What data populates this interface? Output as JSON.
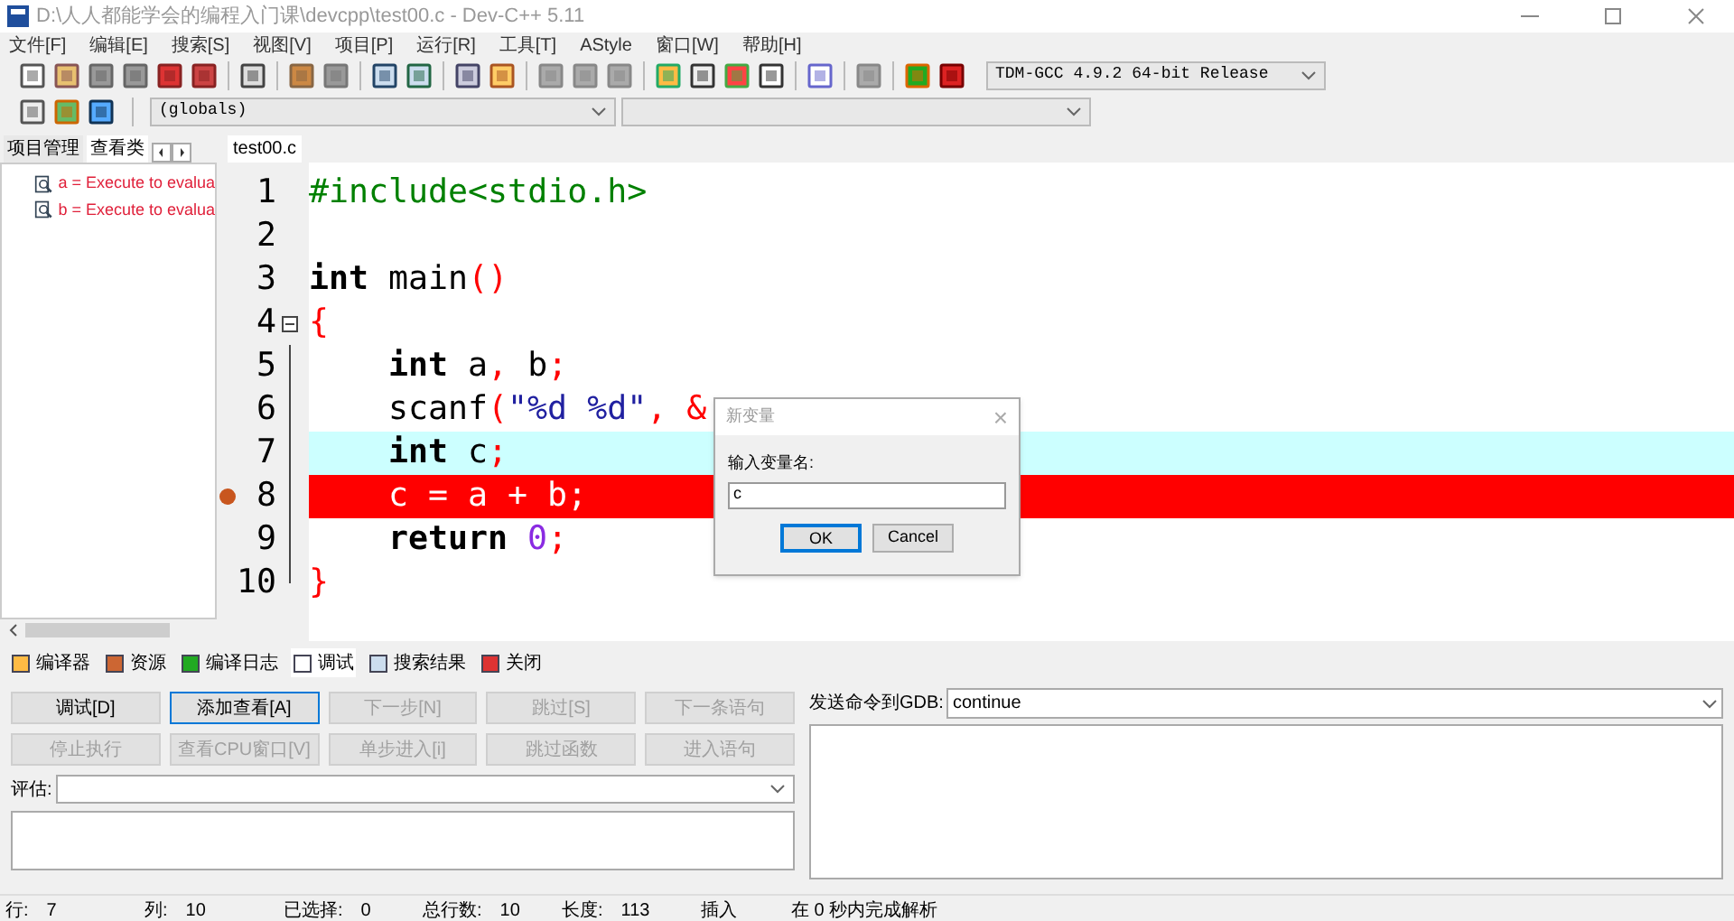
{
  "window": {
    "title": "D:\\人人都能学会的编程入门课\\devcpp\\test00.c - Dev-C++ 5.11"
  },
  "menu": [
    "文件[F]",
    "编辑[E]",
    "搜索[S]",
    "视图[V]",
    "项目[P]",
    "运行[R]",
    "工具[T]",
    "AStyle",
    "窗口[W]",
    "帮助[H]"
  ],
  "compiler_select": {
    "value": "TDM-GCC 4.9.2 64-bit Release"
  },
  "scope_select": {
    "value": "(globals)"
  },
  "left_tabs": [
    {
      "label": "项目管理",
      "selected": false
    },
    {
      "label": "查看类",
      "selected": true
    }
  ],
  "watches": [
    {
      "text": "a = Execute to evalua"
    },
    {
      "text": "b = Execute to evalua"
    }
  ],
  "editor_tabs": [
    {
      "label": "test00.c",
      "selected": true
    }
  ],
  "code_lines": [
    {
      "number": "1",
      "current": false,
      "breakpoint": false,
      "fold": false,
      "tokens": [
        {
          "kind": "pp",
          "text": "#include<stdio.h>"
        }
      ]
    },
    {
      "number": "2",
      "current": false,
      "breakpoint": false,
      "fold": false
    },
    {
      "number": "3",
      "current": false,
      "breakpoint": false,
      "fold": false,
      "tokens": [
        {
          "kind": "kw",
          "text": "int"
        },
        {
          "kind": "plain",
          "text": " main"
        },
        {
          "kind": "sym",
          "text": "()"
        }
      ]
    },
    {
      "number": "4",
      "current": false,
      "breakpoint": false,
      "fold": true,
      "tokens": [
        {
          "kind": "sym",
          "text": "{"
        }
      ]
    },
    {
      "number": "5",
      "current": false,
      "breakpoint": false,
      "fold": false,
      "indented": true,
      "tokens": [
        {
          "kind": "kw",
          "text": "int"
        },
        {
          "kind": "plain",
          "text": " a"
        },
        {
          "kind": "sym",
          "text": ","
        },
        {
          "kind": "plain",
          "text": " b"
        },
        {
          "kind": "sym",
          "text": ";"
        }
      ]
    },
    {
      "number": "6",
      "current": false,
      "breakpoint": false,
      "fold": false,
      "indented": true,
      "tokens": [
        {
          "kind": "plain",
          "text": "scanf"
        },
        {
          "kind": "sym",
          "text": "("
        },
        {
          "kind": "str",
          "text": "\"%d %d\""
        },
        {
          "kind": "sym",
          "text": ", &"
        }
      ]
    },
    {
      "number": "7",
      "current": true,
      "breakpoint": false,
      "fold": false,
      "indented": true,
      "tokens": [
        {
          "kind": "kw",
          "text": "int"
        },
        {
          "kind": "plain",
          "text": " c"
        },
        {
          "kind": "sym",
          "text": ";"
        }
      ]
    },
    {
      "number": "8",
      "current": false,
      "breakpoint": true,
      "fold": false,
      "indented": true,
      "tokens": [
        {
          "kind": "plain",
          "text": "c = a + b;"
        }
      ]
    },
    {
      "number": "9",
      "current": false,
      "breakpoint": false,
      "fold": false,
      "indented": true,
      "tokens": [
        {
          "kind": "kw",
          "text": "return"
        },
        {
          "kind": "num",
          "text": " 0"
        },
        {
          "kind": "sym",
          "text": ";"
        }
      ]
    },
    {
      "number": "10",
      "current": false,
      "breakpoint": false,
      "fold": false,
      "tokens": [
        {
          "kind": "sym",
          "text": "}"
        }
      ]
    }
  ],
  "dialog": {
    "title": "新变量",
    "close": "×",
    "label": "输入变量名:",
    "value": "c",
    "buttons": [
      {
        "label": "OK",
        "selected": true
      },
      {
        "label": "Cancel",
        "selected": false
      }
    ]
  },
  "bottom_tabs": [
    {
      "label": "编译器",
      "selected": false
    },
    {
      "label": "资源",
      "selected": false
    },
    {
      "label": "编译日志",
      "selected": false
    },
    {
      "label": "调试",
      "selected": true
    },
    {
      "label": "搜索结果",
      "selected": false
    },
    {
      "label": "关闭",
      "selected": false
    }
  ],
  "debug_buttons": [
    {
      "label": "调试[D]",
      "disabled": false,
      "focused": false
    },
    {
      "label": "添加查看[A]",
      "disabled": false,
      "focused": true
    },
    {
      "label": "下一步[N]",
      "disabled": true,
      "focused": false
    },
    {
      "label": "跳过[S]",
      "disabled": true,
      "focused": false
    },
    {
      "label": "下一条语句",
      "disabled": true,
      "focused": false
    },
    {
      "label": "停止执行",
      "disabled": true,
      "focused": false
    },
    {
      "label": "查看CPU窗口[V]",
      "disabled": true,
      "focused": false
    },
    {
      "label": "单步进入[i]",
      "disabled": true,
      "focused": false
    },
    {
      "label": "跳过函数",
      "disabled": true,
      "focused": false
    },
    {
      "label": "进入语句",
      "disabled": true,
      "focused": false
    }
  ],
  "evaluate": {
    "label": "评估:"
  },
  "gdb": {
    "label": "发送命令到GDB:",
    "value": "continue"
  },
  "status_bar": [
    {
      "label": "行:",
      "value": "7"
    },
    {
      "label": "列:",
      "value": "10"
    },
    {
      "label": "已选择:",
      "value": "0"
    },
    {
      "label": "总行数:",
      "value": "10"
    },
    {
      "label": "长度:",
      "value": "113"
    },
    {
      "label": "插入"
    },
    {
      "label": "在 0 秒内完成解析"
    }
  ]
}
